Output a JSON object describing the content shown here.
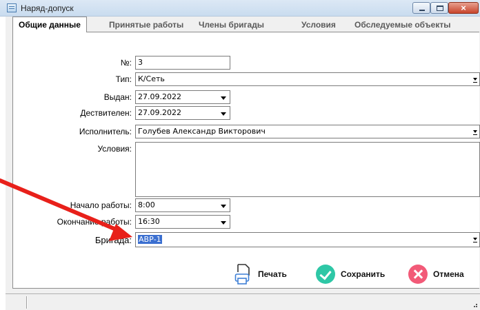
{
  "window": {
    "title": "Наряд-допуск",
    "close_glyph": "×"
  },
  "tabs": [
    {
      "label": "Общие данные",
      "active": true
    },
    {
      "label": "Принятые работы"
    },
    {
      "label": "Члены бригады"
    },
    {
      "label": "Условия"
    },
    {
      "label": "Обследуемые объекты"
    }
  ],
  "form": {
    "number": {
      "label": "№:",
      "value": "3"
    },
    "type": {
      "label": "Тип:",
      "value": "К/Сеть"
    },
    "issued": {
      "label": "Выдан:",
      "value": "27.09.2022"
    },
    "valid": {
      "label": "Дествителен:",
      "value": "27.09.2022"
    },
    "executor": {
      "label": "Исполнитель:",
      "value": "Голубев Александр Викторович"
    },
    "conditions": {
      "label": "Условия:",
      "value": ""
    },
    "start": {
      "label": "Начало работы:",
      "value": "8:00"
    },
    "end": {
      "label": "Окончание работы:",
      "value": "16:30"
    },
    "brigade": {
      "label": "Бригада:",
      "value": "АВР-1"
    }
  },
  "actions": {
    "print": "Печать",
    "save": "Сохранить",
    "cancel": "Отмена"
  },
  "colors": {
    "save": "#2ec7a6",
    "cancel": "#f25a78",
    "arrow": "#e8201a",
    "selection": "#3b6fd0"
  }
}
